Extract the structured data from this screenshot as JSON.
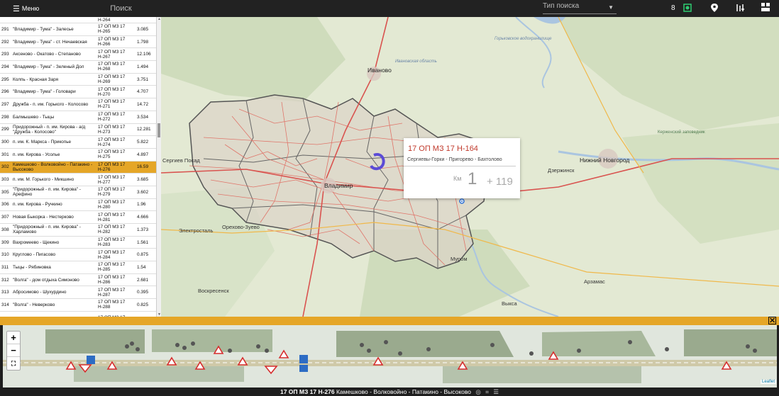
{
  "topbar": {
    "menu_label": "Меню",
    "search_placeholder": "Поиск",
    "search_type_label": "Тип поиска",
    "count": "8",
    "colors": {
      "bg": "#222222",
      "accent_green": "#2ecc71"
    }
  },
  "list": {
    "rows": [
      {
        "num": "",
        "name": "",
        "code": "H-264",
        "len": ""
      },
      {
        "num": "291",
        "name": "\"Владимир - Тума\" - Залесье",
        "code": "17 ОП МЗ 17 Н-265",
        "len": "3.085"
      },
      {
        "num": "292",
        "name": "\"Владимир - Тума\" - ст. Нечаевская",
        "code": "17 ОП МЗ 17 Н-266",
        "len": "1.798"
      },
      {
        "num": "293",
        "name": "Аксеново - Окатово - Степаново",
        "code": "17 ОП МЗ 17 Н-267",
        "len": "12.106"
      },
      {
        "num": "294",
        "name": "\"Владимир - Тума\" - Зеленый Дол",
        "code": "17 ОП МЗ 17 Н-268",
        "len": "1.494"
      },
      {
        "num": "295",
        "name": "Колпь - Красная Заря",
        "code": "17 ОП МЗ 17 Н-269",
        "len": "3.751"
      },
      {
        "num": "296",
        "name": "\"Владимир - Тума\" - Головари",
        "code": "17 ОП МЗ 17 Н-270",
        "len": "4.707"
      },
      {
        "num": "297",
        "name": "Дружба - п. им. Горького - Колосово",
        "code": "17 ОП МЗ 17 Н-271",
        "len": "14.72"
      },
      {
        "num": "298",
        "name": "Балмышево - Тыцы",
        "code": "17 ОП МЗ 17 Н-272",
        "len": "3.534"
      },
      {
        "num": "299",
        "name": "Придорожный - п. им. Кирова - а/д \"Дружба - Колосово\"",
        "code": "17 ОП МЗ 17 Н-273",
        "len": "12.281"
      },
      {
        "num": "300",
        "name": "п. им. К. Маркса - Прикопье",
        "code": "17 ОП МЗ 17 Н-274",
        "len": "5.822"
      },
      {
        "num": "301",
        "name": "п. им. Кирова - Усолье",
        "code": "17 ОП МЗ 17 Н-275",
        "len": "4.897"
      },
      {
        "num": "302",
        "name": "Камешково - Волковойно - Патакино - Высоково",
        "code": "17 ОП МЗ 17 Н-276",
        "len": "16.59",
        "selected": true
      },
      {
        "num": "303",
        "name": "п. им. М. Горького - Микшино",
        "code": "17 ОП МЗ 17 Н-277",
        "len": "3.685"
      },
      {
        "num": "305",
        "name": "\"Придорожный - п. им. Кирова\" - Арефино",
        "code": "17 ОП МЗ 17 Н-279",
        "len": "3.602"
      },
      {
        "num": "306",
        "name": "п. им. Кирова - Ручкино",
        "code": "17 ОП МЗ 17 Н-280",
        "len": "1.96"
      },
      {
        "num": "307",
        "name": "Новая Быкорка - Нестерково",
        "code": "17 ОП МЗ 17 Н-281",
        "len": "4.666"
      },
      {
        "num": "308",
        "name": "\"Придорожный - п. им. Кирова\" - Харламово",
        "code": "17 ОП МЗ 17 Н-282",
        "len": "1.373"
      },
      {
        "num": "309",
        "name": "Вахромеево - Щекино",
        "code": "17 ОП МЗ 17 Н-283",
        "len": "1.561"
      },
      {
        "num": "310",
        "name": "Круглово - Пигасово",
        "code": "17 ОП МЗ 17 Н-284",
        "len": "0.875"
      },
      {
        "num": "311",
        "name": "Тыцы - Рябиновка",
        "code": "17 ОП МЗ 17 Н-285",
        "len": "1.54"
      },
      {
        "num": "312",
        "name": "\"Волга\" - дом отдыха Симоново",
        "code": "17 ОП МЗ 17 Н-286",
        "len": "2.681"
      },
      {
        "num": "313",
        "name": "Абросимово - Шухурдино",
        "code": "17 ОП МЗ 17 Н-287",
        "len": "0.395"
      },
      {
        "num": "314",
        "name": "\"Волга\" - Неверково",
        "code": "17 ОП МЗ 17 Н-288",
        "len": "0.825"
      },
      {
        "num": "",
        "name": "",
        "code": "17 ОП МЗ 17",
        "len": ""
      }
    ],
    "selected_color": "#e5a627"
  },
  "map": {
    "labels": [
      {
        "text": "Иваново",
        "kind": "big"
      },
      {
        "text": "Нижний Новгород",
        "kind": "big"
      },
      {
        "text": "Владимир",
        "kind": "big"
      },
      {
        "text": "Ивановская область",
        "kind": "water"
      },
      {
        "text": "Горьковское водохранилище",
        "kind": "water"
      },
      {
        "text": "Керженский заповедник",
        "kind": "park"
      },
      {
        "text": "Сергиев Посад",
        "kind": "normal"
      },
      {
        "text": "Дзержинск",
        "kind": "normal"
      },
      {
        "text": "Электросталь",
        "kind": "normal"
      },
      {
        "text": "Орехово-Зуево",
        "kind": "normal"
      },
      {
        "text": "Муром",
        "kind": "normal"
      },
      {
        "text": "Арзамас",
        "kind": "normal"
      },
      {
        "text": "Воскресенск",
        "kind": "normal"
      },
      {
        "text": "Выкса",
        "kind": "normal"
      }
    ],
    "popup": {
      "title": "17 ОП МЗ 17 Н-164",
      "subtitle": "Сергиевы-Горки - Пригорево - Бахтолово",
      "km_label": "Км",
      "km_value": "1",
      "km_add": "+ 119"
    }
  },
  "strip": {
    "zoom_in": "+",
    "zoom_out": "−",
    "fullscreen": "⛶",
    "attribution": "Leaflet"
  },
  "status": {
    "road_code": "17 ОП МЗ 17 Н-276",
    "road_name": "Камешково - Волковойно - Патакино - Высоково"
  }
}
